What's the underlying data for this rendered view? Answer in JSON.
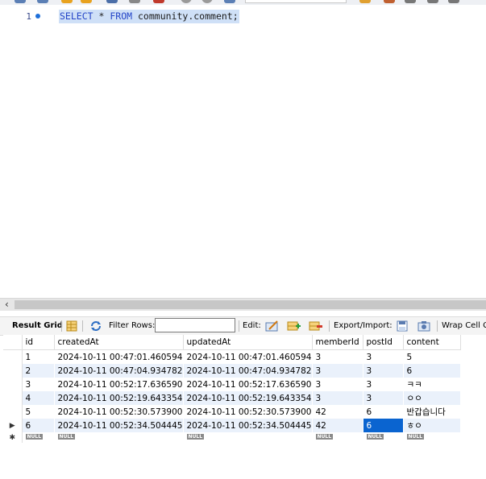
{
  "editor": {
    "line_number": "1",
    "sql": {
      "select": "SELECT",
      "star": "*",
      "from": "FROM",
      "table": "community",
      "dot": ".",
      "name": "comment",
      "semi": ";"
    }
  },
  "result_toolbar": {
    "result_grid": "Result Grid",
    "filter_rows": "Filter Rows:",
    "filter_value": "",
    "edit": "Edit:",
    "export_import": "Export/Import:",
    "wrap_cell": "Wrap Cell Co"
  },
  "grid": {
    "columns": [
      "id",
      "createdAt",
      "updatedAt",
      "memberId",
      "postId",
      "content"
    ],
    "rows": [
      [
        "1",
        "2024-10-11 00:47:01.460594",
        "2024-10-11 00:47:01.460594",
        "3",
        "3",
        "5"
      ],
      [
        "2",
        "2024-10-11 00:47:04.934782",
        "2024-10-11 00:47:04.934782",
        "3",
        "3",
        "6"
      ],
      [
        "3",
        "2024-10-11 00:52:17.636590",
        "2024-10-11 00:52:17.636590",
        "3",
        "3",
        "ㅋㅋ"
      ],
      [
        "4",
        "2024-10-11 00:52:19.643354",
        "2024-10-11 00:52:19.643354",
        "3",
        "3",
        "ㅇㅇ"
      ],
      [
        "5",
        "2024-10-11 00:52:30.573900",
        "2024-10-11 00:52:30.573900",
        "42",
        "6",
        "반갑습니다"
      ],
      [
        "6",
        "2024-10-11 00:52:34.504445",
        "2024-10-11 00:52:34.504445",
        "42",
        "6",
        "ㅎㅇ"
      ]
    ],
    "null_label": "NULL",
    "current_row_marker": "▶",
    "new_row_marker": "✱"
  },
  "colors": {
    "keyword": "#2646c8",
    "selection_bg": "#cfe0f7",
    "selected_cell": "#0a64d0",
    "alt_row": "#eaf1fb"
  }
}
